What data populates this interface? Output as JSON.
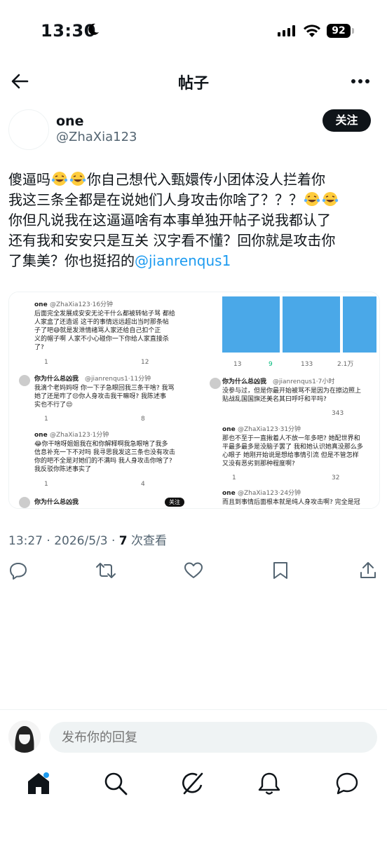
{
  "status_bar": {
    "time": "13:30",
    "battery": "92"
  },
  "header": {
    "title": "帖子"
  },
  "author": {
    "name": "one",
    "handle": "@ZhaXia123",
    "follow_label": "关注"
  },
  "post": {
    "line1a": "傻逼吗",
    "line1b": "你自己想代入甄嬛传小团体没人拦着你",
    "line2": "我这三条全都是在说她们人身攻击你啥了？？？",
    "line3": "你但凡说我在这逼逼啥有本事单独开帖子说我都认了",
    "line4": "还有我和安安只是互关 汉字看不懂？回你就是攻击你",
    "line5": "了集美？你也挺招的",
    "mention": "@jianrenqus1"
  },
  "media": {
    "left": {
      "t1_name": "one",
      "t1_handle": "@ZhaXia123·16分钟",
      "t1_l1": "后面完全发展成安安无论干什么都被转帖子骂 都给",
      "t1_l2": "人家盒了还造谣 这干的事情远远超出当时那条帖",
      "t1_l3": "子了吧😅就是发泄情绪骂人家还给自己扣个正",
      "t1_l4": "义的帽子啊 人家不小心碰你一下你给人家直接杀",
      "t1_l5": "了?",
      "t1_count1": "1",
      "t1_count2": "12",
      "t2_name": "你为什么总凶我",
      "t2_handle": "@jianrenqus1·11分钟",
      "t2_l1": "我滴个老妈妈呀 你一下子急眼回我三条干啥? 我骂",
      "t2_l2": "她了还是咋了😒你人身攻击我干嘛呀? 我陈述事",
      "t2_l3": "实也不行了😒",
      "t2_count1": "1",
      "t2_count2": "8",
      "t3_name": "one",
      "t3_handle": "@ZhaXia123·1分钟",
      "t3_l1": "😂你干啥呀姐姐我在和你解释啊我急眼啥了我多",
      "t3_l2": "信息补充一下不对吗 我寻思我发这三条也没有攻击",
      "t3_l3": "你的吧不全是对她们的不满吗 我人身攻击你啥了?",
      "t3_l4": "我反驳你陈述事实了",
      "t3_count1": "1",
      "t3_count2": "4",
      "t4_name": "你为什么总凶我",
      "t4_follow": "关注"
    },
    "right": {
      "c1": "13",
      "c2": "9",
      "c3": "133",
      "c4": "2.1万",
      "r1_name": "你为什么总凶我",
      "r1_handle": "@jianrenqus1·7小时",
      "r1_l1": "没参与过，但是你最开始被骂不是因为在擦边照上",
      "r1_l2": "贴战乱国国旗还美名其曰呼吁和平吗?",
      "r1_count": "343",
      "r2_name": "one",
      "r2_handle": "@ZhaXia123·31分钟",
      "r2_l1": "那也不至于一直揪着人不放一年多吧? 她配世界和",
      "r2_l2": "平最多最多是没脑子罢了 我和她认识她真没那么多",
      "r2_l3": "心眼子 她刚开始说是想给事情引流 但是不管怎样",
      "r2_l4": "又没有恶劣到那种程度啊?",
      "r2_count1": "1",
      "r2_count2": "32",
      "r3_name": "one",
      "r3_handle": "@ZhaXia123·24分钟",
      "r3_l1": "而且到事情后面根本就是纯人身攻击啊? 完全是冠"
    }
  },
  "meta": {
    "time": "13:27 · 2026/5/3 · ",
    "views": "7",
    "views_label": " 次查看"
  },
  "reply": {
    "placeholder": "发布你的回复"
  },
  "icons": {
    "back": "back-arrow-icon",
    "more": "more-icon",
    "reply": "reply-icon",
    "retweet": "retweet-icon",
    "like": "heart-icon",
    "bookmark": "bookmark-icon",
    "share": "share-icon",
    "home": "home-icon",
    "search": "search-icon",
    "grok": "grok-icon",
    "notifications": "bell-icon",
    "messages": "message-icon"
  },
  "colors": {
    "link": "#1d9bf0",
    "text": "#0f1419",
    "secondary": "#536471",
    "retweet": "#00ba7c"
  }
}
